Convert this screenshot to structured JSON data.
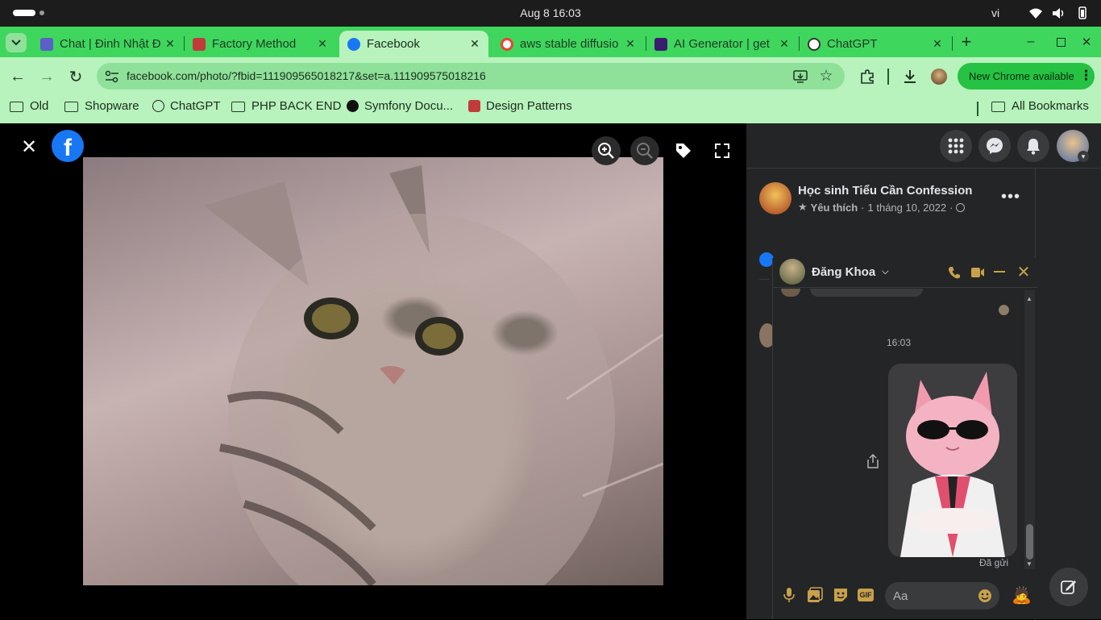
{
  "os": {
    "clock": "Aug 8  16:03",
    "lang": "vi"
  },
  "tabs": [
    {
      "label": "Chat | Đinh Nhật Đ",
      "fav_color": "#5b5fc7"
    },
    {
      "label": "Factory Method",
      "fav_color": "#c23b3b"
    },
    {
      "label": "Facebook",
      "fav_color": "#1877f2"
    },
    {
      "label": "aws stable diffusio",
      "fav_color": "#ffffff"
    },
    {
      "label": "AI Generator | get",
      "fav_color": "#3b1c6e"
    },
    {
      "label": "ChatGPT",
      "fav_color": "#ffffff"
    }
  ],
  "toolbar": {
    "url": "facebook.com/photo/?fbid=111909565018217&set=a.111909575018216",
    "new_chrome": "New Chrome available"
  },
  "bookmarks": [
    {
      "label": "Old",
      "type": "folder"
    },
    {
      "label": "Shopware",
      "type": "folder"
    },
    {
      "label": "ChatGPT",
      "type": "site"
    },
    {
      "label": "PHP BACK END",
      "type": "folder"
    },
    {
      "label": "Symfony Docu...",
      "type": "site"
    },
    {
      "label": "Design Patterns",
      "type": "site"
    }
  ],
  "all_bookmarks": "All Bookmarks",
  "post": {
    "page_name": "Học sinh Tiểu Cần Confession",
    "favorite": "Yêu thích",
    "date": "1 tháng 10, 2022"
  },
  "chat": {
    "name": "Đăng Khoa",
    "time": "16:03",
    "sent": "Đã gửi",
    "input_placeholder": "Aa"
  },
  "colors": {
    "chrome_green": "#3fd65e",
    "chrome_light": "#b8f2bd",
    "fb_blue": "#1877f2",
    "panel": "#242526"
  }
}
